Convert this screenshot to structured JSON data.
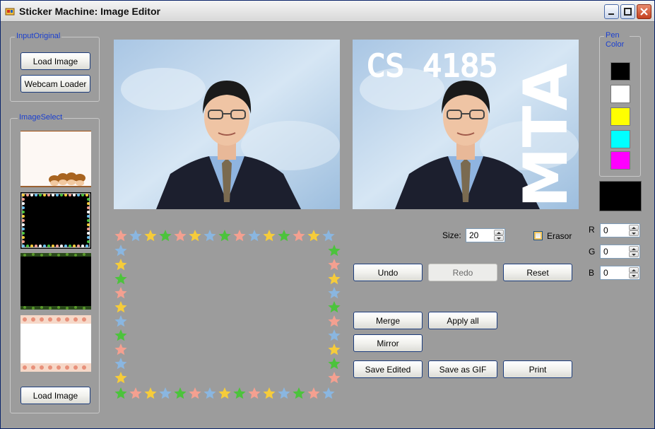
{
  "window": {
    "title": "Sticker Machine: Image Editor"
  },
  "input_original": {
    "label": "InputOriginal",
    "load_image": "Load Image",
    "webcam_loader": "Webcam Loader"
  },
  "image_select": {
    "label": "ImageSelect",
    "load_image": "Load Image"
  },
  "editor": {
    "watermark_top": "CS 4185",
    "watermark_side": "MTA",
    "size_label": "Size:",
    "size_value": "20",
    "erasor_label": "Erasor",
    "undo": "Undo",
    "redo": "Redo",
    "reset": "Reset",
    "merge": "Merge",
    "apply_all": "Apply all",
    "mirror": "Mirror",
    "save_edited": "Save Edited",
    "save_gif": "Save as GIF",
    "print": "Print"
  },
  "pen_color": {
    "label": "Pen Color",
    "swatches": [
      "#000000",
      "#ffffff",
      "#ffff00",
      "#00ffff",
      "#ff00ff"
    ],
    "current": "#000000",
    "r_label": "R",
    "r_value": "0",
    "g_label": "G",
    "g_value": "0",
    "b_label": "B",
    "b_value": "0"
  }
}
